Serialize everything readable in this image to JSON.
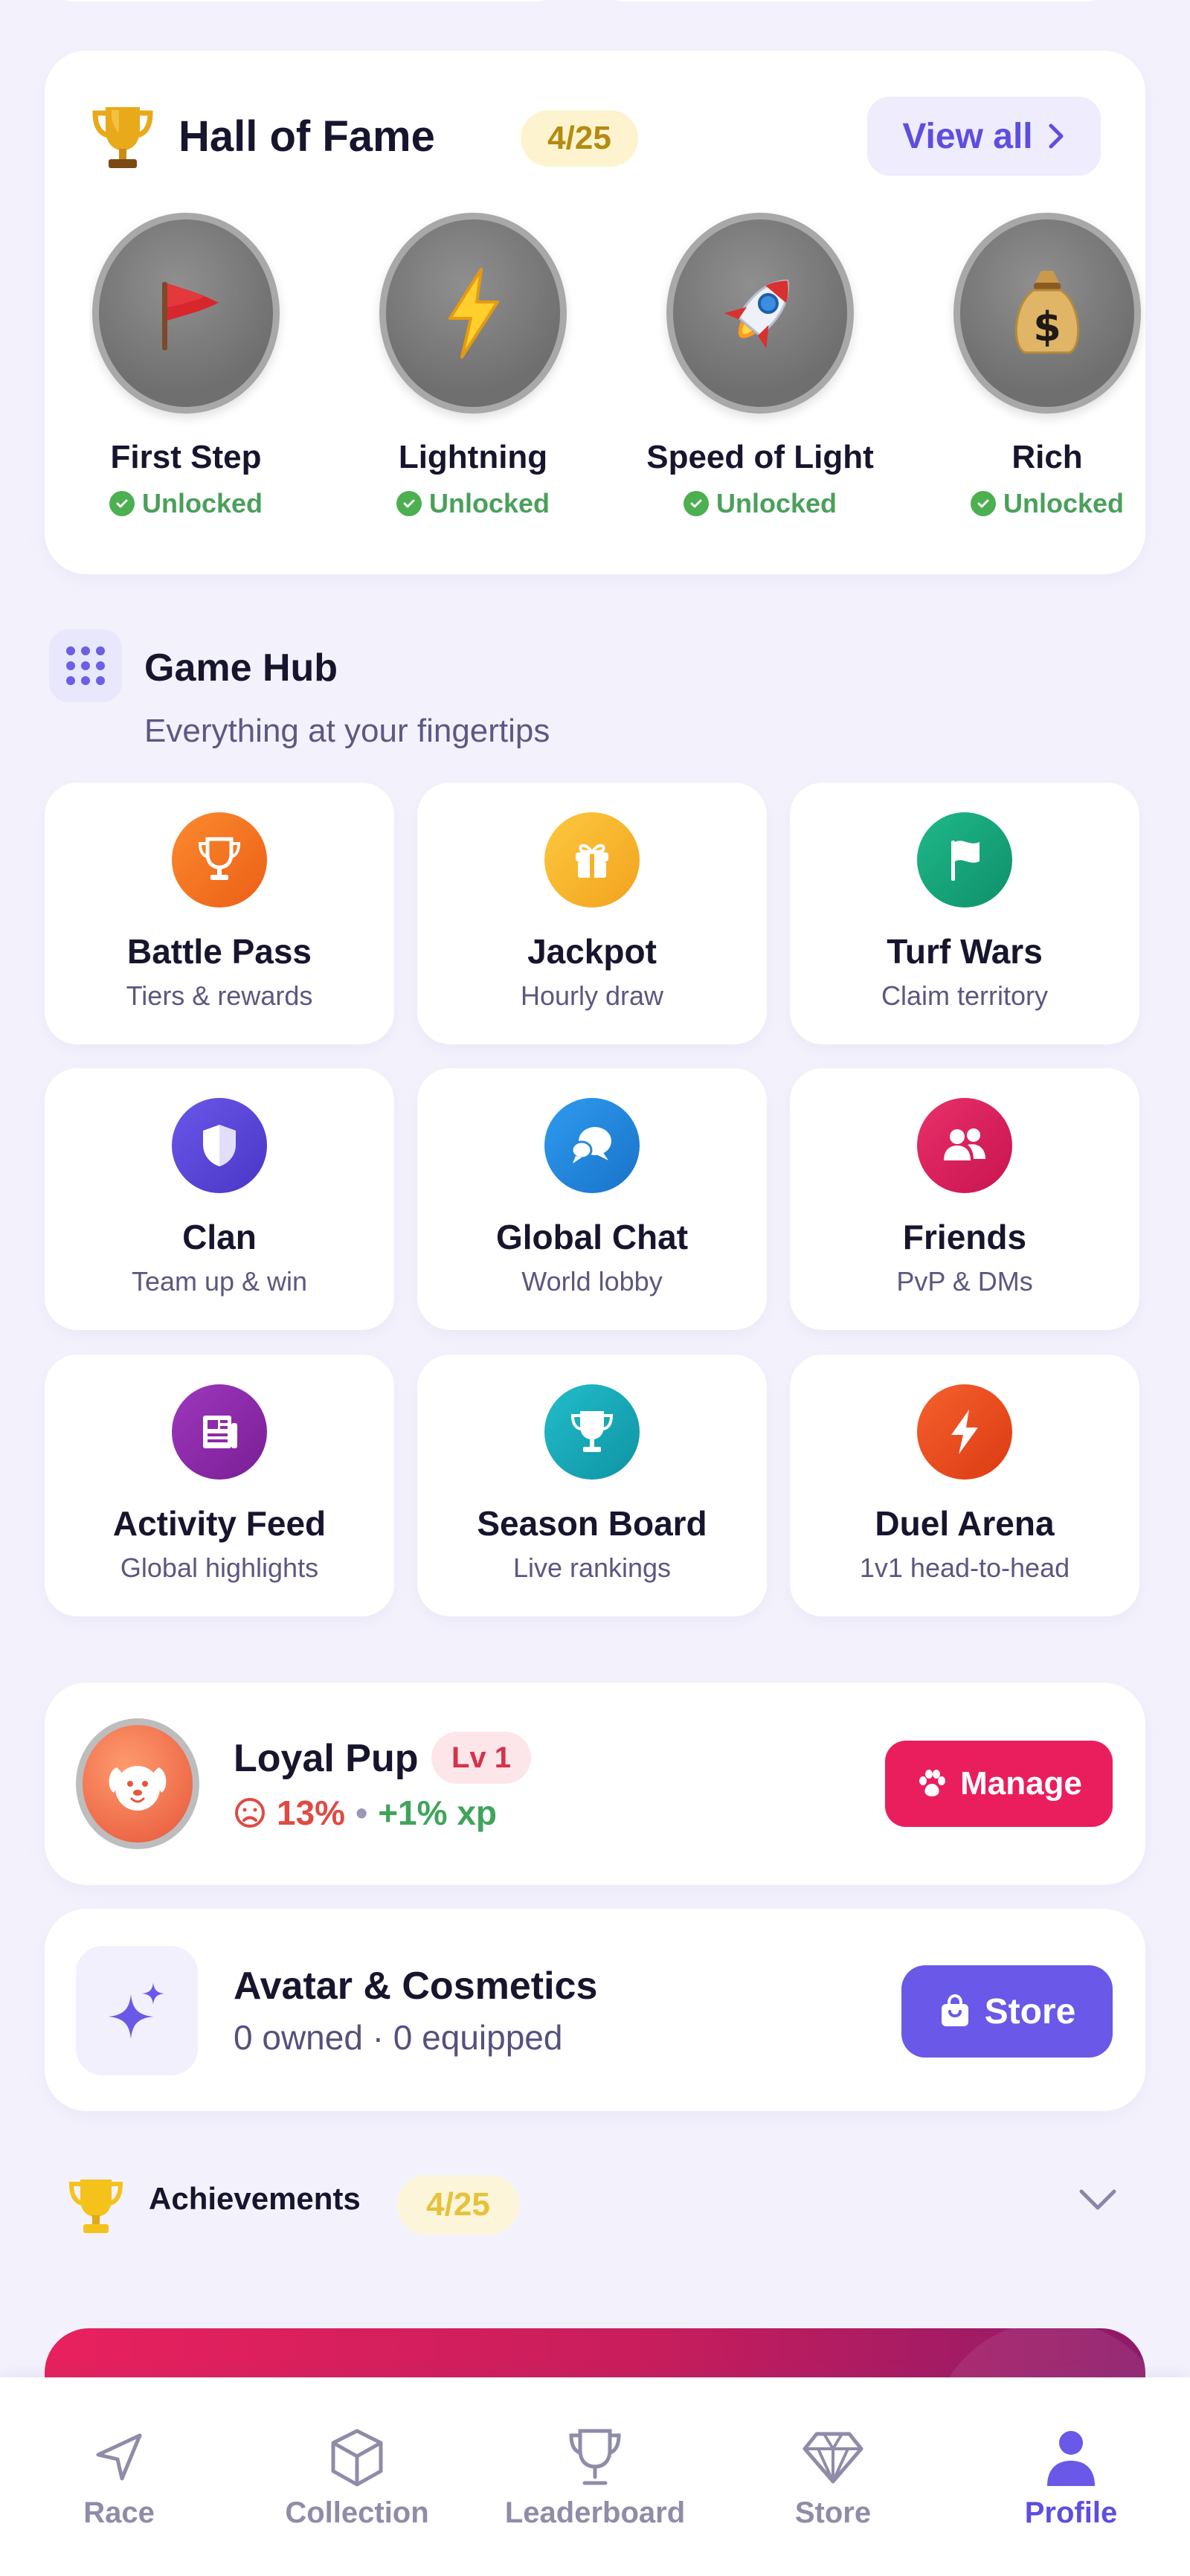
{
  "hall_of_fame": {
    "title": "Hall of Fame",
    "badge": "4/25",
    "view_all": "View all",
    "items": [
      {
        "name": "First Step",
        "status": "Unlocked",
        "emoji": "🚩"
      },
      {
        "name": "Lightning",
        "status": "Unlocked",
        "emoji": "⚡"
      },
      {
        "name": "Speed of Light",
        "status": "Unlocked",
        "emoji": "🚀"
      },
      {
        "name": "Rich",
        "status": "Unlocked",
        "emoji": "💰"
      }
    ]
  },
  "game_hub": {
    "title": "Game Hub",
    "subtitle": "Everything at your fingertips",
    "tiles": [
      {
        "title": "Battle Pass",
        "subtitle": "Tiers & rewards",
        "color": "#f2711c",
        "icon": "trophy-icon"
      },
      {
        "title": "Jackpot",
        "subtitle": "Hourly draw",
        "color": "#f7b02a",
        "icon": "gift-icon"
      },
      {
        "title": "Turf Wars",
        "subtitle": "Claim territory",
        "color": "#1aa37a",
        "icon": "flag-icon"
      },
      {
        "title": "Clan",
        "subtitle": "Team up & win",
        "color": "#5a45d8",
        "icon": "shield-icon"
      },
      {
        "title": "Global Chat",
        "subtitle": "World lobby",
        "color": "#2487dc",
        "icon": "chat-icon"
      },
      {
        "title": "Friends",
        "subtitle": "PvP & DMs",
        "color": "#df1e5b",
        "icon": "users-icon"
      },
      {
        "title": "Activity Feed",
        "subtitle": "Global highlights",
        "color": "#8e2aa8",
        "icon": "newspaper-icon"
      },
      {
        "title": "Season Board",
        "subtitle": "Live rankings",
        "color": "#17a9b8",
        "icon": "trophy-icon"
      },
      {
        "title": "Duel Arena",
        "subtitle": "1v1 head-to-head",
        "color": "#ef4d23",
        "icon": "bolt-icon"
      }
    ]
  },
  "pet": {
    "name": "Loyal Pup",
    "level": "Lv 1",
    "mood": "13%",
    "separator": "•",
    "xp": "+1% xp",
    "manage": "Manage"
  },
  "avatar": {
    "title": "Avatar & Cosmetics",
    "subtitle": "0 owned · 0 equipped",
    "store": "Store"
  },
  "achievements": {
    "title": "Achievements",
    "badge": "4/25"
  },
  "nav": {
    "items": [
      {
        "label": "Race",
        "icon": "navigation-arrow-icon"
      },
      {
        "label": "Collection",
        "icon": "cube-icon"
      },
      {
        "label": "Leaderboard",
        "icon": "trophy-icon"
      },
      {
        "label": "Store",
        "icon": "diamond-icon"
      },
      {
        "label": "Profile",
        "icon": "person-icon",
        "active": true
      }
    ]
  }
}
